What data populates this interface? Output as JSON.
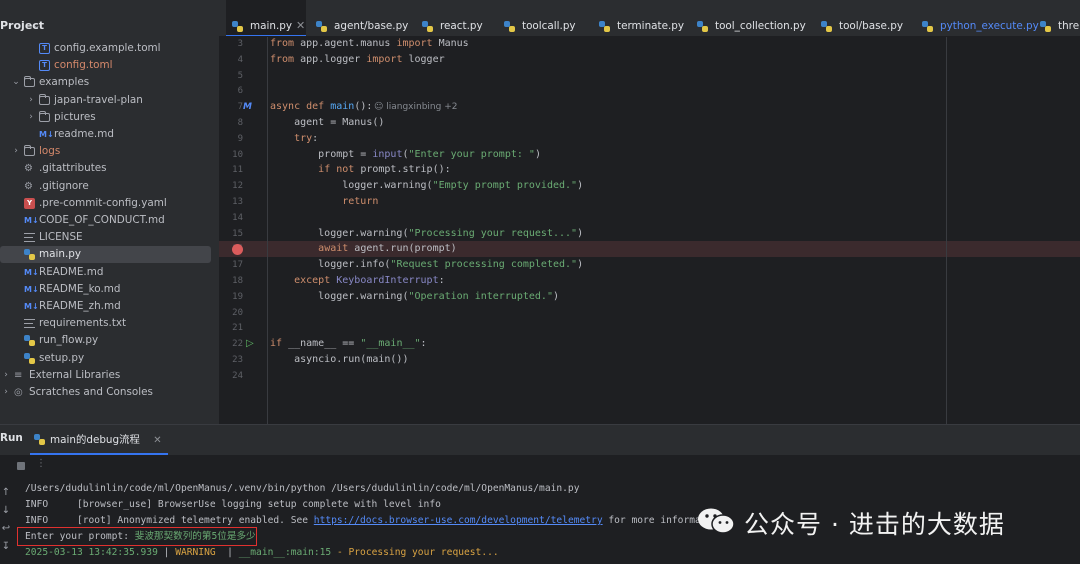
{
  "sidebar": {
    "title": "Project",
    "items": [
      {
        "label": "config.example.toml",
        "icon": "toml-file-icon",
        "arrow": "",
        "indent": 2,
        "color": "#bcbec4"
      },
      {
        "label": "config.toml",
        "icon": "toml-file-icon",
        "arrow": "",
        "indent": 2,
        "color": "#d5896b"
      },
      {
        "label": "examples",
        "icon": "folder-icon",
        "arrow": "v",
        "indent": 1,
        "color": "#bcbec4"
      },
      {
        "label": "japan-travel-plan",
        "icon": "folder-icon",
        "arrow": ">",
        "indent": 2,
        "color": "#bcbec4"
      },
      {
        "label": "pictures",
        "icon": "folder-icon",
        "arrow": ">",
        "indent": 2,
        "color": "#bcbec4"
      },
      {
        "label": "readme.md",
        "icon": "markdown-file-icon",
        "arrow": "",
        "indent": 2,
        "color": "#bcbec4"
      },
      {
        "label": "logs",
        "icon": "folder-icon",
        "arrow": ">",
        "indent": 1,
        "color": "#d5896b"
      },
      {
        "label": ".gitattributes",
        "icon": "gear-file-icon",
        "arrow": "",
        "indent": 1,
        "color": "#bcbec4"
      },
      {
        "label": ".gitignore",
        "icon": "gear-file-icon",
        "arrow": "",
        "indent": 1,
        "color": "#bcbec4"
      },
      {
        "label": ".pre-commit-config.yaml",
        "icon": "yaml-file-icon",
        "arrow": "",
        "indent": 1,
        "color": "#bcbec4"
      },
      {
        "label": "CODE_OF_CONDUCT.md",
        "icon": "markdown-file-icon",
        "arrow": "",
        "indent": 1,
        "color": "#bcbec4"
      },
      {
        "label": "LICENSE",
        "icon": "text-file-icon",
        "arrow": "",
        "indent": 1,
        "color": "#bcbec4"
      },
      {
        "label": "main.py",
        "icon": "python-file-icon",
        "arrow": "",
        "indent": 1,
        "color": "#dfe1e5",
        "selected": true
      },
      {
        "label": "README.md",
        "icon": "markdown-file-icon",
        "arrow": "",
        "indent": 1,
        "color": "#bcbec4"
      },
      {
        "label": "README_ko.md",
        "icon": "markdown-file-icon",
        "arrow": "",
        "indent": 1,
        "color": "#bcbec4"
      },
      {
        "label": "README_zh.md",
        "icon": "markdown-file-icon",
        "arrow": "",
        "indent": 1,
        "color": "#bcbec4"
      },
      {
        "label": "requirements.txt",
        "icon": "text-file-icon",
        "arrow": "",
        "indent": 1,
        "color": "#bcbec4"
      },
      {
        "label": "run_flow.py",
        "icon": "python-file-icon",
        "arrow": "",
        "indent": 1,
        "color": "#bcbec4"
      },
      {
        "label": "setup.py",
        "icon": "python-file-icon",
        "arrow": "",
        "indent": 1,
        "color": "#bcbec4"
      },
      {
        "label": "External Libraries",
        "icon": "library-icon",
        "arrow": ">",
        "indent": 0,
        "color": "#bcbec4"
      },
      {
        "label": "Scratches and Consoles",
        "icon": "scratch-icon",
        "arrow": ">",
        "indent": 0,
        "color": "#bcbec4"
      }
    ]
  },
  "tabs": [
    {
      "label": "main.py",
      "active": true,
      "closable": true
    },
    {
      "label": "agent/base.py"
    },
    {
      "label": "react.py"
    },
    {
      "label": "toolcall.py"
    },
    {
      "label": "terminate.py"
    },
    {
      "label": "tool_collection.py"
    },
    {
      "label": "tool/base.py"
    },
    {
      "label": "python_execute.py",
      "color": "#548af7"
    },
    {
      "label": "thre"
    }
  ],
  "editor": {
    "author_hint": "liangxinbing +2",
    "lines": [
      {
        "n": "3",
        "html": "<span class=\"kw\">from</span> app.agent.manus <span class=\"kw\">import</span> Manus"
      },
      {
        "n": "4",
        "html": "<span class=\"kw\">from</span> app.logger <span class=\"kw\">import</span> logger"
      },
      {
        "n": "5",
        "html": ""
      },
      {
        "n": "6",
        "html": ""
      },
      {
        "n": "7",
        "html": "<span class=\"kw\">async def</span> <span class=\"fn\">main</span>():",
        "marker": "m"
      },
      {
        "n": "8",
        "html": "    agent = Manus()"
      },
      {
        "n": "9",
        "html": "    <span class=\"kw\">try</span>:"
      },
      {
        "n": "10",
        "html": "        prompt = <span class=\"bi\">input</span>(<span class=\"str\">\"Enter your prompt: \"</span>)"
      },
      {
        "n": "11",
        "html": "        <span class=\"kw\">if not</span> prompt.strip():"
      },
      {
        "n": "12",
        "html": "            logger.warning(<span class=\"str\">\"Empty prompt provided.\"</span>)"
      },
      {
        "n": "13",
        "html": "            <span class=\"kw\">return</span>"
      },
      {
        "n": "14",
        "html": ""
      },
      {
        "n": "15",
        "html": "        logger.warning(<span class=\"str\">\"Processing your request...\"</span>)"
      },
      {
        "n": "16",
        "html": "        <span class=\"kw\">await</span> agent.run(prompt)",
        "breakpoint": true
      },
      {
        "n": "17",
        "html": "        logger.info(<span class=\"str\">\"Request processing completed.\"</span>)"
      },
      {
        "n": "18",
        "html": "    <span class=\"kw\">except</span> <span class=\"bi\">KeyboardInterrupt</span>:"
      },
      {
        "n": "19",
        "html": "        logger.warning(<span class=\"str\">\"Operation interrupted.\"</span>)"
      },
      {
        "n": "20",
        "html": ""
      },
      {
        "n": "21",
        "html": ""
      },
      {
        "n": "22",
        "html": "<span class=\"kw\">if</span> __name__ == <span class=\"str\">\"__main__\"</span>:",
        "marker": "run"
      },
      {
        "n": "23",
        "html": "    asyncio.run(main())"
      },
      {
        "n": "24",
        "html": ""
      }
    ]
  },
  "run": {
    "title": "Run",
    "tab_label": "main的debug流程",
    "console": [
      {
        "html": "/Users/dudulinlin/code/ml/OpenManus/.venv/bin/python /Users/dudulinlin/code/ml/OpenManus/main.py"
      },
      {
        "html": "INFO     [browser_use] BrowserUse logging setup complete with level info"
      },
      {
        "html": "INFO     [root] Anonymized telemetry enabled. See <span class=\"link\">https://docs.browser-use.com/development/telemetry</span> for more information."
      },
      {
        "html": "Enter your prompt: <span class=\"input\">斐波那契数列的第5位是多少</span>"
      },
      {
        "html": "<span class=\"ts\">2025-03-13 13:42:35.939</span> | <span class=\"warn\">WARNING </span> | <span class=\"dim\">__main__:main:15</span> <span class=\"warn\">- Processing your request...</span>"
      }
    ]
  },
  "watermark": {
    "text": "公众号 · 进击的大数据"
  },
  "colors": {
    "accent": "#3574f0",
    "breakpoint": "#db5c5c",
    "highlight_box": "#e0312f"
  }
}
